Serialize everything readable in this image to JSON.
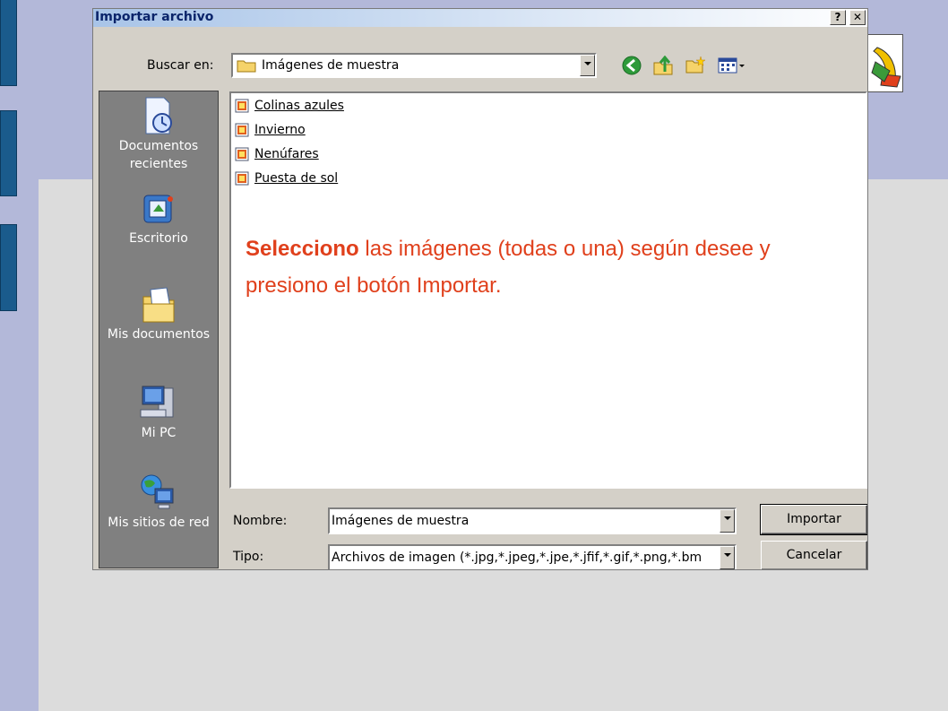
{
  "dialog": {
    "title": "Importar archivo",
    "help_label": "?",
    "close_label": "✕"
  },
  "lookin": {
    "label": "Buscar en:",
    "value": "Imágenes de muestra"
  },
  "toolbar": {
    "icons": [
      "back-icon",
      "up-folder-icon",
      "new-folder-icon",
      "view-menu-icon"
    ]
  },
  "places": [
    {
      "id": "recientes",
      "label": "Documentos recientes",
      "icon": "recent-documents-icon"
    },
    {
      "id": "escritorio",
      "label": "Escritorio",
      "icon": "desktop-icon"
    },
    {
      "id": "misdocs",
      "label": "Mis documentos",
      "icon": "my-documents-icon"
    },
    {
      "id": "mipc",
      "label": "Mi PC",
      "icon": "my-computer-icon"
    },
    {
      "id": "red",
      "label": "Mis sitios de red",
      "icon": "network-places-icon"
    }
  ],
  "files": [
    {
      "name": "Colinas azules"
    },
    {
      "name": "Invierno"
    },
    {
      "name": "Nenúfares"
    },
    {
      "name": "Puesta de sol"
    }
  ],
  "note": {
    "bold": "Selecciono",
    "text": " las imágenes (todas o una) según desee y presiono el botón Importar.",
    "color": "#e0401c"
  },
  "filename": {
    "label": "Nombre:",
    "value": "Imágenes de muestra"
  },
  "filetype": {
    "label": "Tipo:",
    "value": "Archivos de imagen (*.jpg,*.jpeg,*.jpe,*.jfif,*.gif,*.png,*.bm"
  },
  "buttons": {
    "import": "Importar",
    "cancel": "Cancelar"
  }
}
